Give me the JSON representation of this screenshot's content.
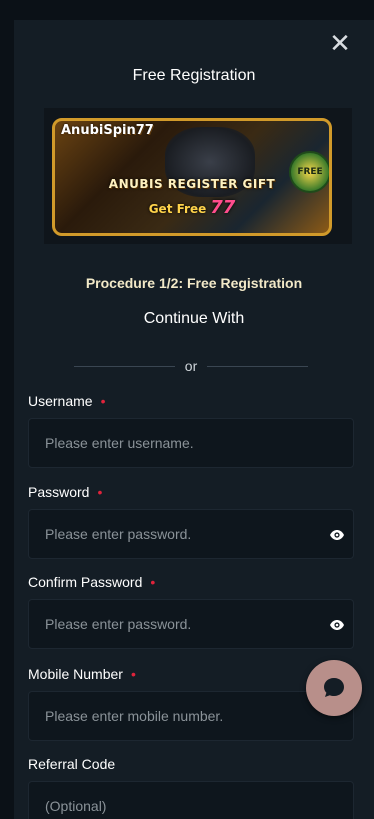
{
  "modal": {
    "title": "Free Registration",
    "close_icon": "close-icon"
  },
  "banner": {
    "logo_text": "AnubiSpin77",
    "headline": "ANUBIS REGISTER GIFT",
    "sub_text": "Get Free",
    "sub_number": "77",
    "badge": "FREE"
  },
  "procedure": "Procedure 1/2: Free Registration",
  "continue_with": "Continue With",
  "divider_text": "or",
  "fields": {
    "username": {
      "label": "Username",
      "placeholder": "Please enter username."
    },
    "password": {
      "label": "Password",
      "placeholder": "Please enter password."
    },
    "confirm_password": {
      "label": "Confirm Password",
      "placeholder": "Please enter password."
    },
    "mobile": {
      "label": "Mobile Number",
      "placeholder": "Please enter mobile number."
    },
    "referral": {
      "label": "Referral Code",
      "placeholder": "(Optional)"
    }
  },
  "required_marker": "•",
  "icons": {
    "eye": "eye-icon",
    "chat": "chat-bubble-icon"
  },
  "colors": {
    "required": "#e0233b",
    "background": "#141d25",
    "input_bg": "#0e161d",
    "chat_fab": "#b88f8a"
  }
}
